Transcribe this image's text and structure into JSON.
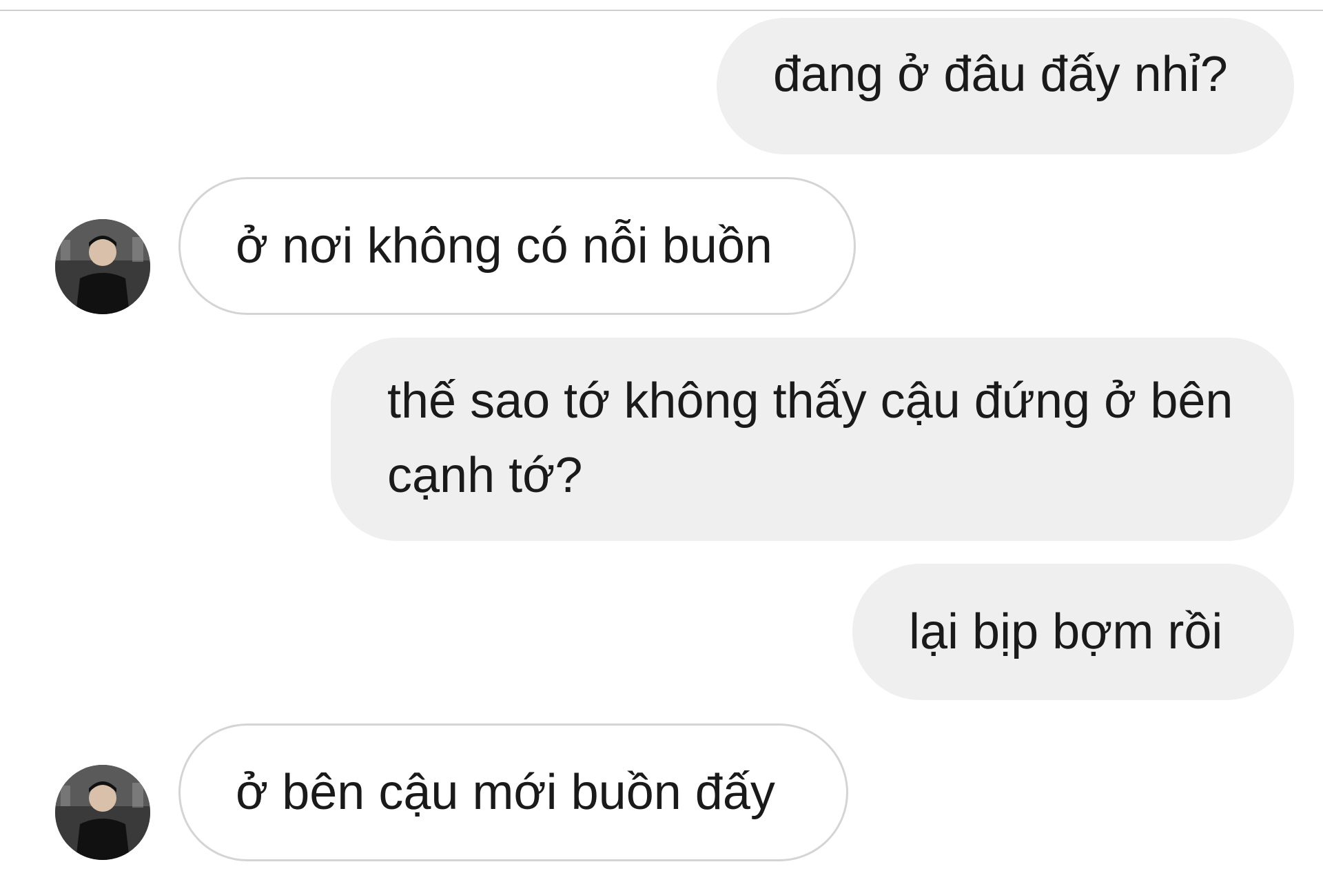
{
  "conversation": {
    "messages": [
      {
        "direction": "sent",
        "text": "đang ở đâu đấy nhỉ?"
      },
      {
        "direction": "received",
        "text": "ở nơi không có nỗi buồn",
        "avatar": "profile-photo"
      },
      {
        "direction": "sent",
        "text": "thế sao tớ không thấy cậu đứng ở bên cạnh tớ?"
      },
      {
        "direction": "sent",
        "text": "lại bịp bợm rồi"
      },
      {
        "direction": "received",
        "text": "ở bên cậu mới buồn đấy",
        "avatar": "profile-photo"
      }
    ]
  },
  "colors": {
    "sent_bubble": "#efefef",
    "received_bubble_border": "#d4d4d4",
    "text": "#1a1a1a",
    "background": "#ffffff"
  }
}
